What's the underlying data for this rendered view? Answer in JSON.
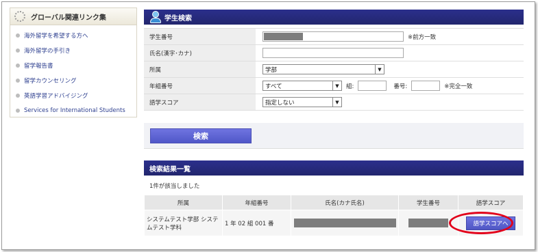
{
  "sidebar": {
    "title": "グローバル関連リンク集",
    "items": [
      {
        "label": "海外留学を希望する方へ"
      },
      {
        "label": "海外留学の手引き"
      },
      {
        "label": "留学報告書"
      },
      {
        "label": "留学カウンセリング"
      },
      {
        "label": "英語学習アドバイジング"
      },
      {
        "label": "Services for International Students"
      }
    ]
  },
  "search": {
    "title": "学生検索",
    "fields": {
      "student_number": {
        "label": "学生番号",
        "note": "※前方一致"
      },
      "name": {
        "label": "氏名(漢字･カナ)",
        "value": ""
      },
      "affiliation": {
        "label": "所属",
        "value": "学部"
      },
      "grade_class": {
        "label": "年組番号",
        "year_value": "すべて",
        "class_label": "組:",
        "number_label": "番号:",
        "note": "※完全一致"
      },
      "language_score": {
        "label": "語学スコア",
        "value": "指定しない"
      }
    },
    "button_label": "検索"
  },
  "results": {
    "title": "検索結果一覧",
    "count_text": "1件が該当しました",
    "columns": [
      "所属",
      "年組番号",
      "氏名(カナ氏名)",
      "学生番号",
      "語学スコア"
    ],
    "rows": [
      {
        "affiliation": "システムテスト学部 システムテスト学科",
        "grade_class": "1 年 02 組 001 番",
        "score_button": "語学スコアへ"
      }
    ]
  },
  "colors": {
    "header_navy": "#25287a",
    "button_blue": "#5a60d4",
    "highlight_red": "#e2001a"
  }
}
